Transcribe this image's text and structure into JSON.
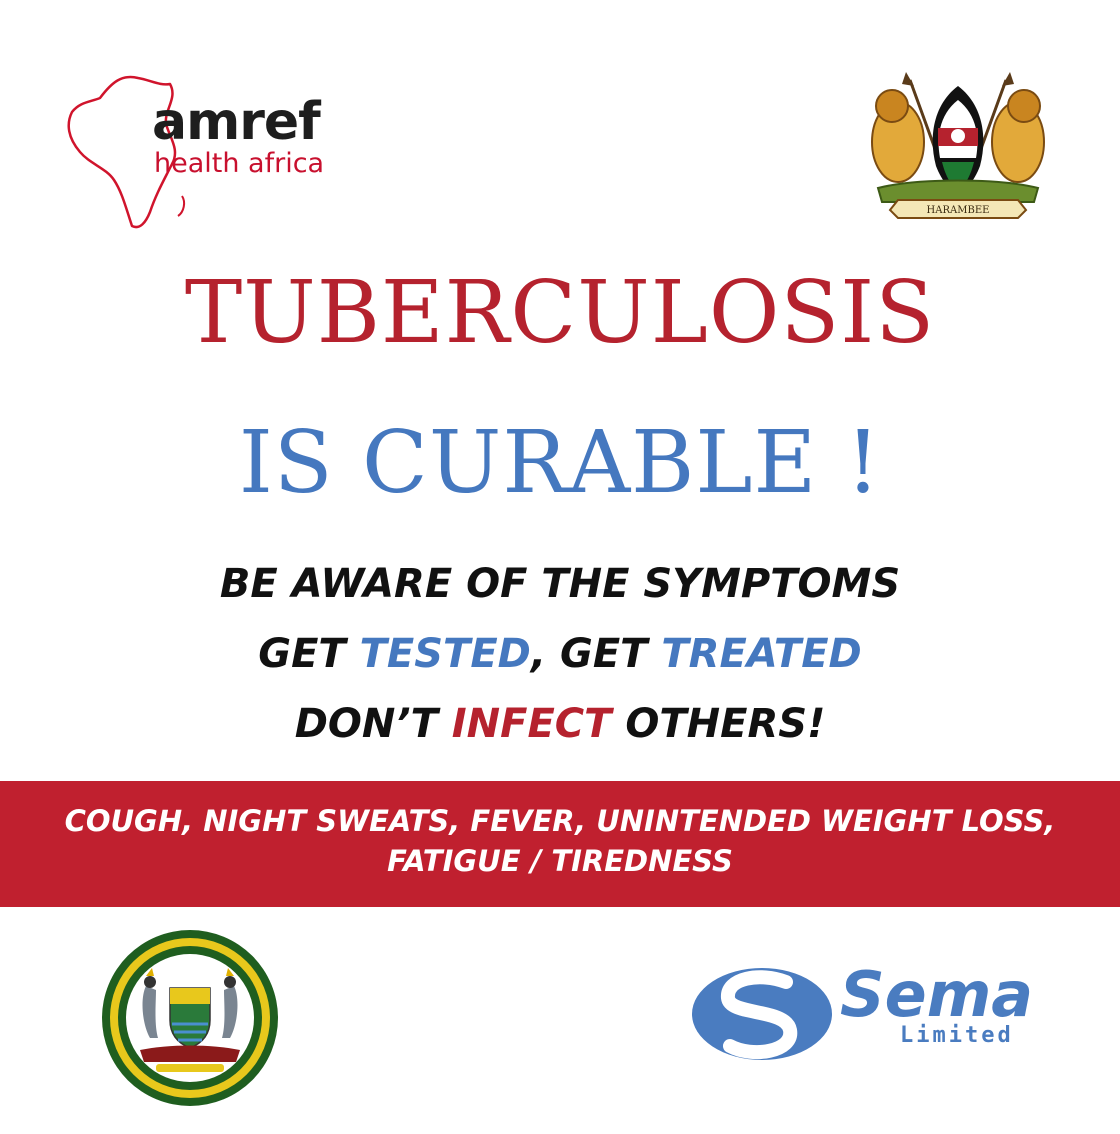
{
  "logos": {
    "amref_name": "amref",
    "amref_sub": "health africa",
    "coat_of_arms_motto": "HARAMBEE",
    "sema_name": "Sema",
    "sema_sub": "Limited"
  },
  "headline": {
    "line1": "TUBERCULOSIS",
    "line2": "IS CURABLE !"
  },
  "messages": {
    "line1": "BE AWARE OF THE SYMPTOMS",
    "line2_a": "GET ",
    "line2_b": "TESTED",
    "line2_c": ", GET ",
    "line2_d": "TREATED",
    "line3_a": "DON’T ",
    "line3_b": "INFECT",
    "line3_c": " OTHERS!"
  },
  "symptoms": {
    "line1": "COUGH, NIGHT SWEATS, FEVER, UNINTENDED WEIGHT LOSS,",
    "line2": "FATIGUE / TIREDNESS"
  },
  "colors": {
    "red": "#b5222e",
    "blue": "#4578bf",
    "banner": "#c0202f",
    "amref_red": "#c8102e",
    "seal_green": "#1f5e1f",
    "seal_gold": "#e8c81c"
  }
}
